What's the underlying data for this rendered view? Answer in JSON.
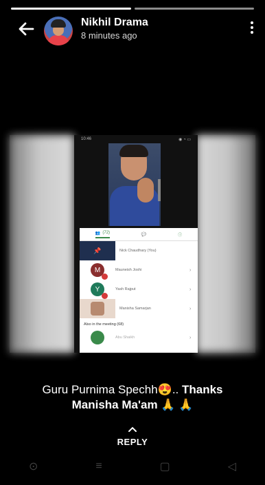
{
  "story": {
    "author_name": "Nikhil Drama",
    "posted_time": "8 minutes ago",
    "progress_segments": [
      1,
      0
    ],
    "caption_plain": "Guru Purnima Spechh😍.. ",
    "caption_bold_1": "Thanks",
    "caption_bold_2": "Manisha Ma'am",
    "caption_emoji": "🙏 🙏",
    "reply_label": "REPLY"
  },
  "screenshot": {
    "status_time": "10:46",
    "tab_participants": "(72)",
    "participants": [
      {
        "name": "Nick Chaudhary (You)",
        "initial": "",
        "color": "#1f2f4f"
      },
      {
        "name": "Mauneish Joshi",
        "initial": "M",
        "color": "#8a2e2e"
      },
      {
        "name": "Yash Rajput",
        "initial": "Y",
        "color": "#1f7a5a"
      },
      {
        "name": "Manisha Samarjan",
        "initial": "",
        "color": "#b78a70"
      }
    ],
    "also_in_meeting": "Also in the meeting (68)",
    "last_name": "Abu Shaikh"
  },
  "colors": {
    "accent": "#3a8a4a",
    "badge": "#d43b3b"
  }
}
